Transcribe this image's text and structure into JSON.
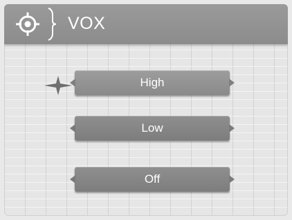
{
  "header": {
    "title": "VOX",
    "icon": "crosshair-icon"
  },
  "menu": {
    "items": [
      {
        "label": "High",
        "selected": true
      },
      {
        "label": "Low",
        "selected": false
      },
      {
        "label": "Off",
        "selected": false
      }
    ]
  },
  "selector_icon": "four-point-star-icon",
  "colors": {
    "header_bg": "#8f8f8f",
    "button_bg": "#858585",
    "text": "#ffffff",
    "background": "#e6e6e6"
  }
}
